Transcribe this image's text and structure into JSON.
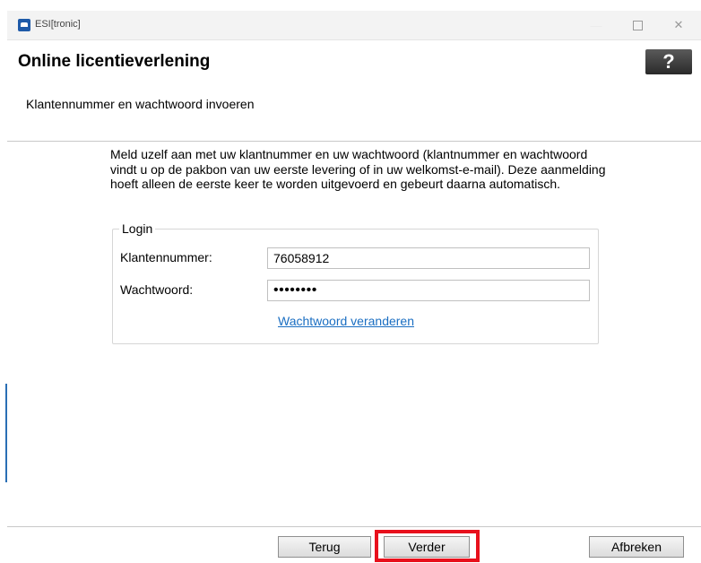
{
  "window": {
    "title": "ESI[tronic]",
    "controls": {
      "minimize": "—",
      "close": "✕"
    }
  },
  "header": {
    "title": "Online licentieverlening",
    "help_label": "?",
    "subtitle": "Klantennummer en wachtwoord invoeren"
  },
  "content": {
    "intro": "Meld uzelf aan met uw klantnummer en uw wachtwoord (klantnummer en wachtwoord vindt u op de pakbon van uw eerste levering of in uw welkomst-e-mail). Deze aanmelding hoeft alleen de eerste keer te worden uitgevoerd en gebeurt daarna automatisch.",
    "login": {
      "legend": "Login",
      "customer_number_label": "Klantennummer:",
      "customer_number_value": "76058912",
      "password_label": "Wachtwoord:",
      "password_value": "••••••••",
      "change_password_link": "Wachtwoord veranderen"
    }
  },
  "footer": {
    "back_label": "Terug",
    "next_label": "Verder",
    "cancel_label": "Afbreken"
  },
  "colors": {
    "highlight": "#e8101c",
    "link": "#1a6ec2"
  }
}
